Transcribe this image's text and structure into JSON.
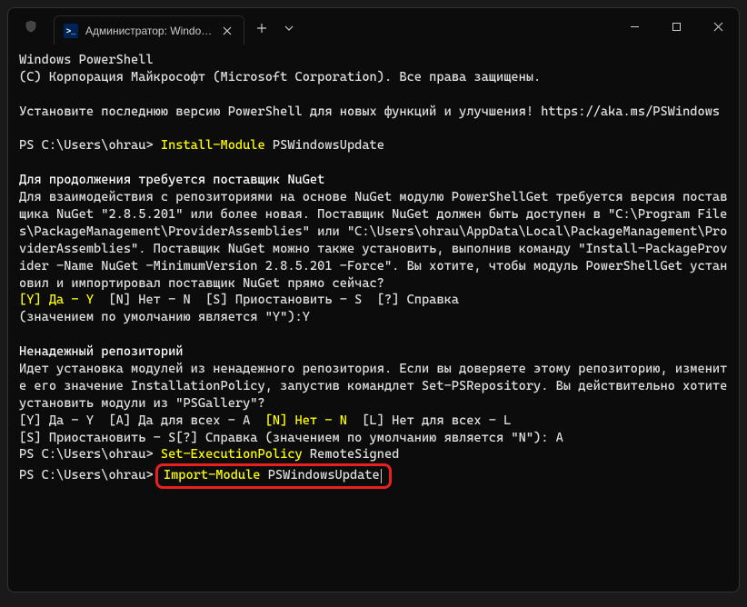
{
  "tab": {
    "title": "Администратор: Windows Po"
  },
  "terminal": {
    "header1": "Windows PowerShell",
    "header2": "(C) Корпорация Майкрософт (Microsoft Corporation). Все права защищены.",
    "install_note": "Установите последнюю версию PowerShell для новых функций и улучшения! https://aka.ms/PSWindows",
    "prompt1": "PS C:\\Users\\ohrau> ",
    "cmd1_yellow": "Install-Module",
    "cmd1_arg": " PSWindowsUpdate",
    "nuget_title": "Для продолжения требуется поставщик NuGet",
    "nuget_body": "Для взаимодействия с репозиториями на основе NuGet модулю PowerShellGet требуется версия поставщика NuGet \"2.8.5.201\" или более новая. Поставщик NuGet должен быть доступен в \"C:\\Program Files\\PackageManagement\\ProviderAssemblies\" или \"C:\\Users\\ohrau\\AppData\\Local\\PackageManagement\\ProviderAssemblies\". Поставщик NuGet можно также установить, выполнив команду \"Install-PackageProvider -Name NuGet -MinimumVersion 2.8.5.201 -Force\". Вы хотите, чтобы модуль PowerShellGet установил и импортировал поставщик NuGet прямо сейчас?",
    "nuget_opts_yellow": "[Y] Да - Y",
    "nuget_opts_rest": "  [N] Нет - N  [S] Приостановить - S  [?] Справка",
    "nuget_default": "(значением по умолчанию является \"Y\"):Y",
    "repo_title": "Ненадежный репозиторий",
    "repo_body": "Идет установка модулей из ненадежного репозитория. Если вы доверяете этому репозиторию, измените его значение InstallationPolicy, запустив командлет Set-PSRepository. Вы действительно хотите установить модули из \"PSGallery\"?",
    "repo_opts1_a": "[Y] Да - Y  [A] Да для всех - A  ",
    "repo_opts1_yellow": "[N] Нет - N",
    "repo_opts1_b": "  [L] Нет для всех - L",
    "repo_opts2": "[S] Приостановить - S[?] Справка (значением по умолчанию является \"N\"): A",
    "prompt2": "PS C:\\Users\\ohrau> ",
    "cmd2_yellow": "Set-ExecutionPolicy",
    "cmd2_arg": " RemoteSigned",
    "prompt3": "PS C:\\Users\\ohrau> ",
    "cmd3_yellow": "Import-Module",
    "cmd3_arg": " PSWindowsUpdate"
  }
}
